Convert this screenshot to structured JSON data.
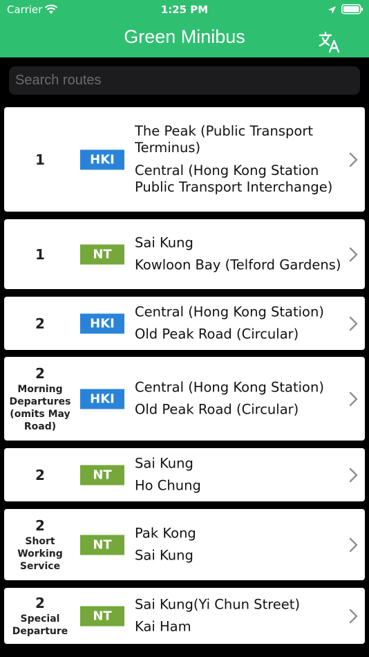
{
  "status_bar": {
    "carrier": "Carrier",
    "time": "1:25 PM"
  },
  "nav": {
    "title": "Green Minibus"
  },
  "search": {
    "placeholder": "Search routes"
  },
  "colors": {
    "header": "#2fbf71",
    "hki_badge": "#2a83d9",
    "nt_badge": "#76a73a"
  },
  "routes": [
    {
      "number": "1",
      "note": "",
      "region": "HKI",
      "origin": "The Peak (Public Transport Terminus)",
      "destination": "Central (Hong Kong Station Public Transport Interchange)"
    },
    {
      "number": "1",
      "note": "",
      "region": "NT",
      "origin": "Sai Kung",
      "destination": "Kowloon Bay (Telford Gardens)"
    },
    {
      "number": "2",
      "note": "",
      "region": "HKI",
      "origin": "Central (Hong Kong Station)",
      "destination": "Old Peak Road (Circular)"
    },
    {
      "number": "2",
      "note": "Morning Departures (omits May Road)",
      "region": "HKI",
      "origin": "Central (Hong Kong Station)",
      "destination": "Old Peak Road (Circular)"
    },
    {
      "number": "2",
      "note": "",
      "region": "NT",
      "origin": "Sai Kung",
      "destination": "Ho Chung"
    },
    {
      "number": "2",
      "note": "Short Working Service",
      "region": "NT",
      "origin": "Pak Kong",
      "destination": "Sai Kung"
    },
    {
      "number": "2",
      "note": "Special Departure",
      "region": "NT",
      "origin": "Sai Kung(Yi Chun Street)",
      "destination": " Kai Ham"
    }
  ]
}
